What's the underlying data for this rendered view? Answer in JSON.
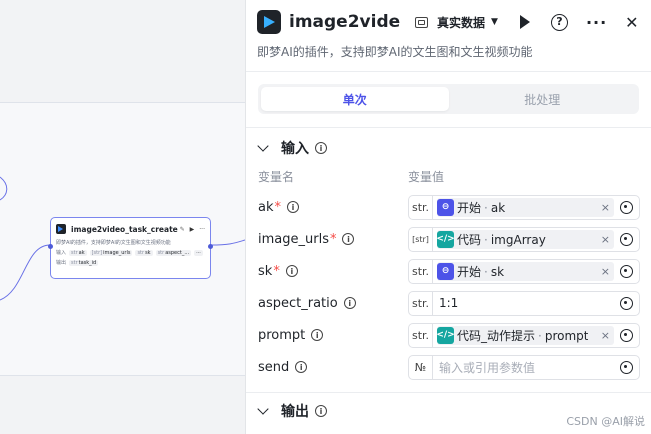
{
  "node": {
    "title": "image2video_task_create",
    "edit_glyph": "✎",
    "run_glyph": "▶",
    "more_glyph": "···",
    "desc": "即梦AI的插件，支持即梦AI的文生图和文生视频功能",
    "input_label": "输入",
    "inputs": [
      {
        "type": "str",
        "name": "ak"
      },
      {
        "type": "[str]",
        "name": "image_urls"
      },
      {
        "type": "str",
        "name": "sk"
      },
      {
        "type": "str",
        "name": "aspect_..."
      }
    ],
    "input_more": "···",
    "output_label": "输出",
    "outputs": [
      {
        "type": "str",
        "name": "task_id"
      }
    ]
  },
  "panel": {
    "title": "image2vide···",
    "mode_label": "真实数据",
    "mode_caret": "▼",
    "help_glyph": "?",
    "more_glyph": "···",
    "close_glyph": "✕",
    "desc": "即梦AI的插件，支持即梦AI的文生图和文生视频功能",
    "tabs": [
      {
        "label": "单次",
        "active": true
      },
      {
        "label": "批处理",
        "active": false
      }
    ],
    "input_section": {
      "title": "输入",
      "col_name": "变量名",
      "col_value": "变量值",
      "params": [
        {
          "name": "ak",
          "required": true,
          "type": "str.",
          "kind": "ref",
          "source": "start",
          "icon_glyph": "⊖",
          "node": "开始",
          "var": "ak"
        },
        {
          "name": "image_urls",
          "required": true,
          "type": "[str]",
          "kind": "ref",
          "source": "code",
          "icon_glyph": "</>",
          "node": "代码",
          "var": "imgArray"
        },
        {
          "name": "sk",
          "required": true,
          "type": "str.",
          "kind": "ref",
          "source": "start",
          "icon_glyph": "⊖",
          "node": "开始",
          "var": "sk"
        },
        {
          "name": "aspect_ratio",
          "required": false,
          "type": "str.",
          "kind": "text",
          "value": "1:1"
        },
        {
          "name": "prompt",
          "required": false,
          "type": "str.",
          "kind": "ref",
          "source": "code",
          "icon_glyph": "</>",
          "node": "代码_动作提示",
          "var": "prompt"
        },
        {
          "name": "send",
          "required": false,
          "type": "№",
          "kind": "empty",
          "placeholder": "输入或引用参数值"
        }
      ]
    },
    "output_section": {
      "title": "输出"
    }
  },
  "ref_separator": "·",
  "required_mark": "*",
  "info_glyph": "i",
  "clear_glyph": "×",
  "watermark": "CSDN @AI解说",
  "colors": {
    "accent": "#4d53e8",
    "code": "#15a6a0",
    "required": "#f54a45"
  }
}
